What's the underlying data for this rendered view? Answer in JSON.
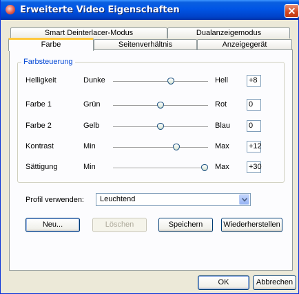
{
  "window": {
    "title": "Erweiterte Video Eigenschaften",
    "close_glyph": "✕"
  },
  "tabs": {
    "row1": [
      "Smart Deinterlacer-Modus",
      "Dualanzeigemodus"
    ],
    "row2": [
      "Farbe",
      "Seitenverhältnis",
      "Anzeigegerät"
    ],
    "active": "Farbe"
  },
  "color_control": {
    "group_label": "Farbsteuerung",
    "sliders": [
      {
        "label": "Helligkeit",
        "min_label": "Dunke",
        "max_label": "Hell",
        "value": "+8",
        "position": 0.62
      },
      {
        "label": "Farbe 1",
        "min_label": "Grün",
        "max_label": "Rot",
        "value": "0",
        "position": 0.5
      },
      {
        "label": "Farbe 2",
        "min_label": "Gelb",
        "max_label": "Blau",
        "value": "0",
        "position": 0.5
      },
      {
        "label": "Kontrast",
        "min_label": "Min",
        "max_label": "Max",
        "value": "+12",
        "position": 0.68
      },
      {
        "label": "Sättigung",
        "min_label": "Min",
        "max_label": "Max",
        "value": "+30",
        "position": 1.0
      }
    ]
  },
  "profile": {
    "label": "Profil verwenden:",
    "selected": "Leuchtend"
  },
  "buttons": {
    "new": "Neu...",
    "delete": "Löschen",
    "save": "Speichern",
    "restore": "Wiederherstellen",
    "ok": "OK",
    "cancel": "Abbrechen"
  },
  "colors": {
    "titlebar": "#0055E5",
    "group_label": "#0046D5",
    "tab_highlight": "#FFC83C"
  }
}
